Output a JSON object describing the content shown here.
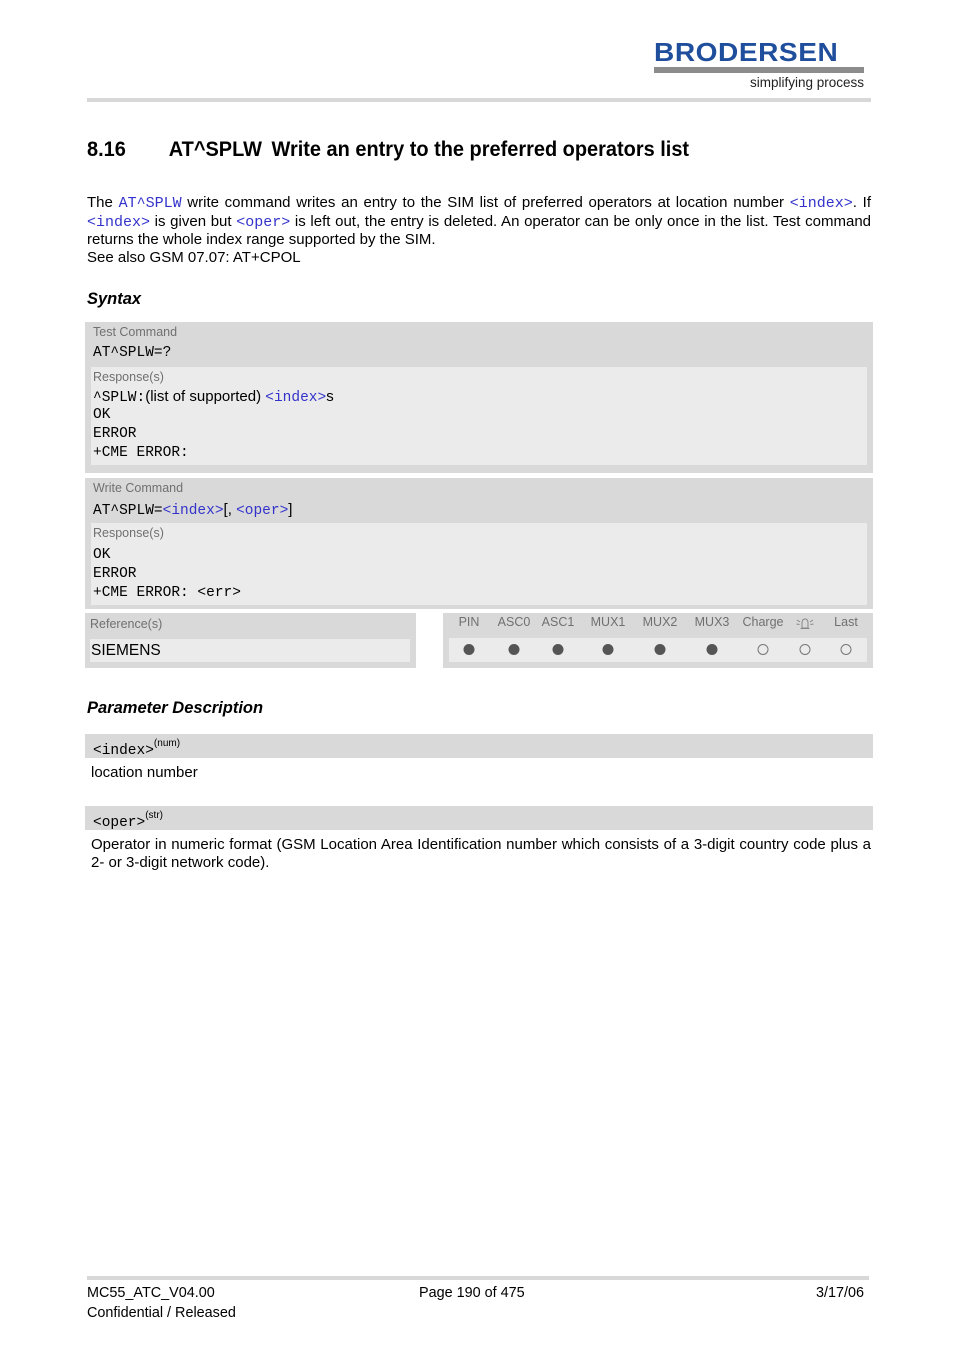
{
  "header": {
    "logo_text": "BRODERSEN",
    "logo_tagline": "simplifying process",
    "brand_color": "#1f4e9c"
  },
  "section": {
    "number": "8.16",
    "command": "AT^SPLW",
    "title": "Write an entry to the preferred operators list"
  },
  "intro": {
    "l1_pre": "The ",
    "l1_cmd": "AT^SPLW",
    "l1_mid": " write command writes an entry to the SIM list of preferred operators at location number ",
    "l1_param": "<index>",
    "l1_post": ".",
    "l2_pre": "If ",
    "l2_param1": "<index>",
    "l2_mid": " is given but ",
    "l2_param2": "<oper>",
    "l2_post": " is left out, the entry is deleted. An operator can be only once in the list. Test command returns the whole index range supported by the SIM.",
    "l3": "See also GSM 07.07: AT+CPOL"
  },
  "syntax": {
    "heading": "Syntax",
    "test": {
      "label": "Test Command",
      "command": "AT^SPLW=?",
      "response_label": "Response(s)",
      "resp1_mono": "^SPLW:",
      "resp1_text": "(list of supported) ",
      "resp1_param": "<index>",
      "resp1_suffix": "s",
      "lines": [
        "OK",
        "ERROR",
        "+CME ERROR:"
      ]
    },
    "write": {
      "label": "Write Command",
      "command_prefix": "AT^SPLW=",
      "param1": "<index>",
      "sep": "[, ",
      "param2": "<oper>",
      "close": "]",
      "response_label": "Response(s)",
      "lines": [
        "OK",
        "ERROR",
        "+CME ERROR: <err>"
      ]
    },
    "reference": {
      "label": "Reference(s)",
      "value": "SIEMENS"
    },
    "flags": {
      "headers": [
        "PIN",
        "ASC0",
        "ASC1",
        "MUX1",
        "MUX2",
        "MUX3",
        "Charge",
        "alarm-bell-icon",
        "Last"
      ],
      "states": [
        "on",
        "on",
        "on",
        "on",
        "on",
        "on",
        "off",
        "off",
        "off"
      ]
    }
  },
  "params": {
    "heading": "Parameter Description",
    "items": [
      {
        "name": "<index>",
        "type": "(num)",
        "description": "location number"
      },
      {
        "name": "<oper>",
        "type": "(str)",
        "description": "Operator in numeric format (GSM Location Area Identification number which consists of a 3-digit country code plus a 2- or 3-digit network code)."
      }
    ]
  },
  "footer": {
    "doc_id": "MC55_ATC_V04.00",
    "status": "Confidential / Released",
    "page": "Page 190 of 475",
    "date": "3/17/06"
  }
}
